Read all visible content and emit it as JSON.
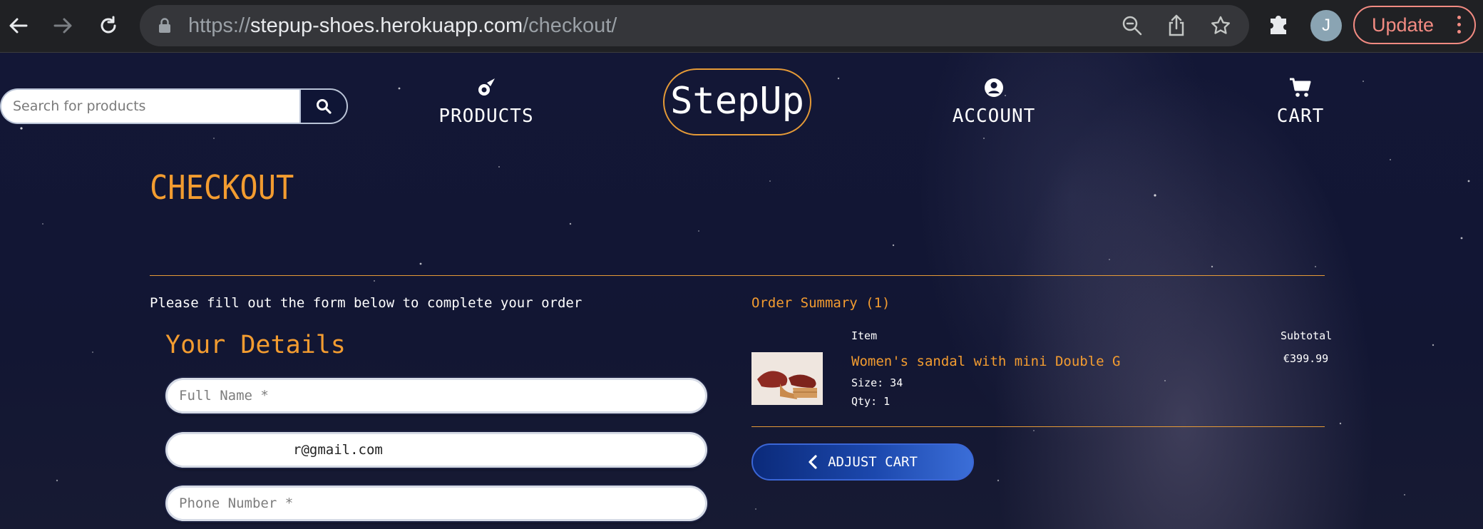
{
  "browser": {
    "url_scheme": "https://",
    "url_host": "stepup-shoes.herokuapp.com",
    "url_path": "/checkout/",
    "avatar_letter": "J",
    "update_label": "Update"
  },
  "header": {
    "search_placeholder": "Search for products",
    "nav": {
      "products": "PRODUCTS",
      "account": "ACCOUNT",
      "cart": "CART"
    },
    "logo": "StepUp"
  },
  "checkout": {
    "title": "CHECKOUT",
    "intro": "Please fill out the form below to complete your order",
    "details_heading": "Your Details",
    "fields": {
      "full_name_placeholder": "Full Name *",
      "email_value": "r@gmail.com",
      "phone_placeholder": "Phone Number *"
    }
  },
  "order_summary": {
    "title": "Order Summary (1)",
    "col_item": "Item",
    "col_subtotal": "Subtotal",
    "items": [
      {
        "name": "Women's sandal with mini Double G",
        "size": "Size: 34",
        "qty": "Qty: 1",
        "subtotal": "€399.99"
      }
    ],
    "adjust_cart_label": "ADJUST CART"
  },
  "colors": {
    "accent": "#f39c30",
    "background": "#131736",
    "button_blue": "#1c48ad"
  }
}
